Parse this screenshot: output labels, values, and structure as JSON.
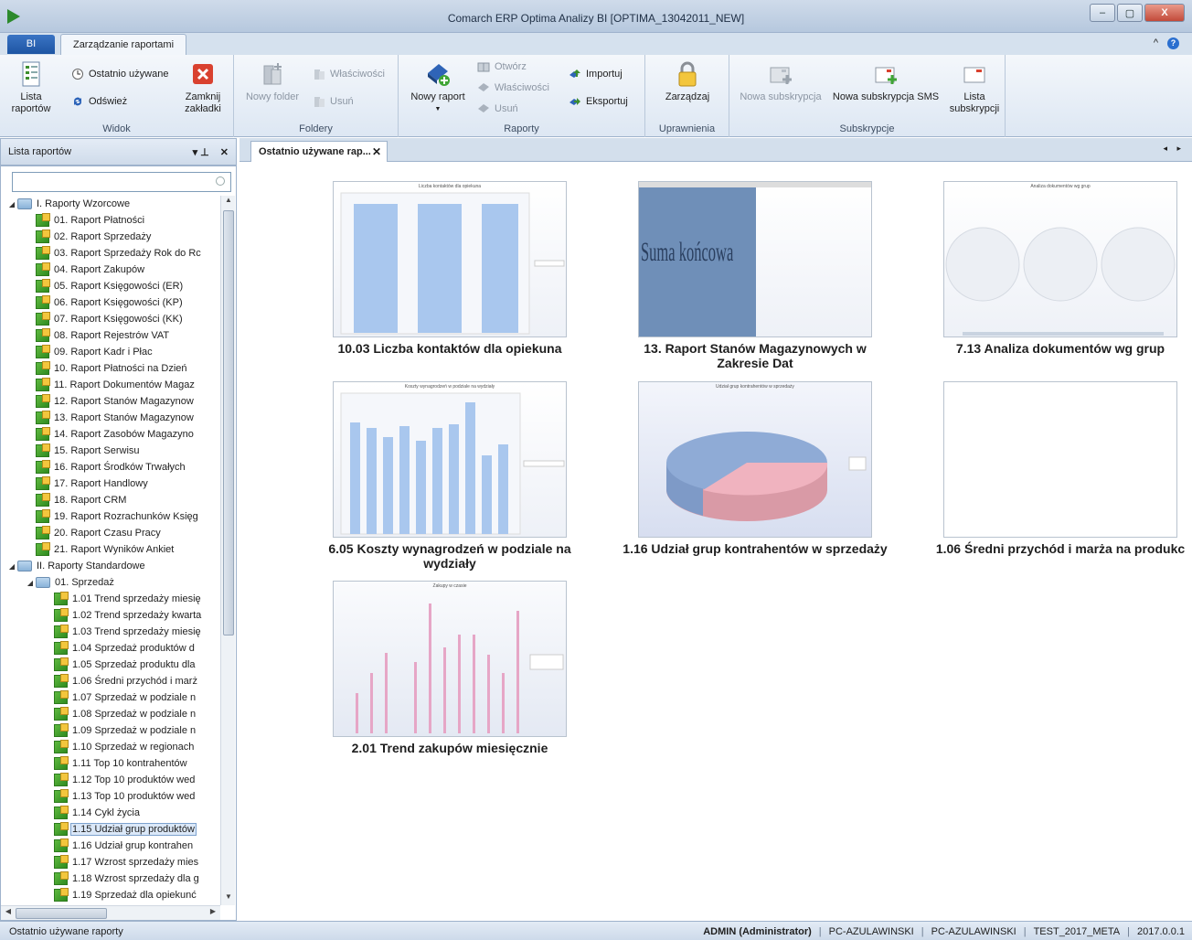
{
  "window": {
    "title": "Comarch ERP Optima Analizy BI [OPTIMA_13042011_NEW]",
    "minimize": "–",
    "maximize": "▢",
    "close": "X"
  },
  "ribbon_tabs": {
    "app_tab": "BI",
    "active_tab": "Zarządzanie raportami"
  },
  "ribbon": {
    "widok": {
      "label": "Widok",
      "lista_raportow": "Lista raportów",
      "ostatnio_uzywane": "Ostatnio używane",
      "odswiez": "Odśwież",
      "zamknij_zakladki": "Zamknij zakładki"
    },
    "foldery": {
      "label": "Foldery",
      "nowy_folder": "Nowy folder",
      "wlasciwosci": "Właściwości",
      "usun": "Usuń"
    },
    "raporty": {
      "label": "Raporty",
      "nowy_raport": "Nowy raport",
      "otworz": "Otwórz",
      "wlasciwosci": "Właściwości",
      "usun": "Usuń",
      "importuj": "Importuj",
      "eksportuj": "Eksportuj"
    },
    "uprawnienia": {
      "label": "Uprawnienia",
      "zarzadzaj": "Zarządzaj"
    },
    "subskrypcje": {
      "label": "Subskrypcje",
      "nowa_subskrypcja": "Nowa subskrypcja",
      "nowa_subskrypcja_sms": "Nowa subskrypcja SMS",
      "lista_subskrypcji": "Lista subskrypcji"
    }
  },
  "left_pane": {
    "title": "Lista raportów",
    "search_placeholder": "",
    "pin": "▾  ⊥",
    "close": "✕"
  },
  "tree": [
    {
      "level": 0,
      "type": "folder",
      "label": "I. Raporty Wzorcowe"
    },
    {
      "level": 1,
      "type": "report",
      "label": "01. Raport Płatności"
    },
    {
      "level": 1,
      "type": "report",
      "label": "02. Raport Sprzedaży"
    },
    {
      "level": 1,
      "type": "report",
      "label": "03. Raport Sprzedaży Rok do Rc"
    },
    {
      "level": 1,
      "type": "report",
      "label": "04. Raport Zakupów"
    },
    {
      "level": 1,
      "type": "report",
      "label": "05. Raport Księgowości (ER)"
    },
    {
      "level": 1,
      "type": "report",
      "label": "06. Raport Księgowości (KP)"
    },
    {
      "level": 1,
      "type": "report",
      "label": "07. Raport Księgowości (KK)"
    },
    {
      "level": 1,
      "type": "report",
      "label": "08. Raport Rejestrów VAT"
    },
    {
      "level": 1,
      "type": "report",
      "label": "09. Raport Kadr i Płac"
    },
    {
      "level": 1,
      "type": "report",
      "label": "10. Raport Płatności na Dzień"
    },
    {
      "level": 1,
      "type": "report",
      "label": "11. Raport Dokumentów Magaz"
    },
    {
      "level": 1,
      "type": "report",
      "label": "12. Raport Stanów Magazynow"
    },
    {
      "level": 1,
      "type": "report",
      "label": "13. Raport Stanów Magazynow"
    },
    {
      "level": 1,
      "type": "report",
      "label": "14. Raport Zasobów Magazyno"
    },
    {
      "level": 1,
      "type": "report",
      "label": "15. Raport Serwisu"
    },
    {
      "level": 1,
      "type": "report",
      "label": "16. Raport Środków Trwałych"
    },
    {
      "level": 1,
      "type": "report",
      "label": "17. Raport Handlowy"
    },
    {
      "level": 1,
      "type": "report",
      "label": "18. Raport CRM"
    },
    {
      "level": 1,
      "type": "report",
      "label": "19. Raport Rozrachunków Księg"
    },
    {
      "level": 1,
      "type": "report",
      "label": "20. Raport Czasu Pracy"
    },
    {
      "level": 1,
      "type": "report",
      "label": "21. Raport Wyników Ankiet"
    },
    {
      "level": 0,
      "type": "folder",
      "label": "II. Raporty Standardowe"
    },
    {
      "level": 1,
      "type": "folder",
      "label": "01. Sprzedaż"
    },
    {
      "level": 2,
      "type": "report",
      "label": "1.01 Trend sprzedaży miesię"
    },
    {
      "level": 2,
      "type": "report",
      "label": "1.02 Trend sprzedaży kwarta"
    },
    {
      "level": 2,
      "type": "report",
      "label": "1.03 Trend sprzedaży miesię"
    },
    {
      "level": 2,
      "type": "report",
      "label": "1.04 Sprzedaż produktów d"
    },
    {
      "level": 2,
      "type": "report",
      "label": "1.05 Sprzedaż produktu dla"
    },
    {
      "level": 2,
      "type": "report",
      "label": "1.06 Średni przychód i marż"
    },
    {
      "level": 2,
      "type": "report",
      "label": "1.07 Sprzedaż w podziale n"
    },
    {
      "level": 2,
      "type": "report",
      "label": "1.08 Sprzedaż w podziale n"
    },
    {
      "level": 2,
      "type": "report",
      "label": "1.09 Sprzedaż w podziale n"
    },
    {
      "level": 2,
      "type": "report",
      "label": "1.10 Sprzedaż w regionach"
    },
    {
      "level": 2,
      "type": "report",
      "label": "1.11 Top 10 kontrahentów"
    },
    {
      "level": 2,
      "type": "report",
      "label": "1.12 Top 10 produktów wed"
    },
    {
      "level": 2,
      "type": "report",
      "label": "1.13 Top 10 produktów wed"
    },
    {
      "level": 2,
      "type": "report",
      "label": "1.14 Cykl życia"
    },
    {
      "level": 2,
      "type": "report",
      "label": "1.15 Udział grup produktów",
      "selected": true
    },
    {
      "level": 2,
      "type": "report",
      "label": "1.16 Udział grup kontrahen"
    },
    {
      "level": 2,
      "type": "report",
      "label": "1.17 Wzrost sprzedaży mies"
    },
    {
      "level": 2,
      "type": "report",
      "label": "1.18 Wzrost sprzedaży dla g"
    },
    {
      "level": 2,
      "type": "report",
      "label": "1.19 Sprzedaż dla opiekunć"
    }
  ],
  "main": {
    "tab_label": "Ostatnio używane rap...",
    "tab_close": "✕",
    "tab_nav": "◂ ▸",
    "cards": [
      {
        "caption": "10.03 Liczba kontaktów dla opiekuna",
        "thumb_title": "Liczba kontaktów dla opiekuna"
      },
      {
        "caption": "13. Raport Stanów Magazynowych w Zakresie Dat",
        "thumb_text": "Suma końcowa"
      },
      {
        "caption": "7.13 Analiza dokumentów wg grup",
        "thumb_title": "Analiza dokumentów wg grup"
      },
      {
        "caption": "6.05 Koszty wynagrodzeń w podziale na wydziały",
        "thumb_title": "Koszty wynagrodzeń w podziale na wydziały"
      },
      {
        "caption": "1.16 Udział grup kontrahentów w sprzedaży",
        "thumb_title": "Udział grup kontrahentów w sprzedaży"
      },
      {
        "caption": "1.06 Średni przychód i marża na produkc",
        "thumb_title": ""
      },
      {
        "caption": "2.01 Trend zakupów miesięcznie",
        "thumb_title": "Zakupy w czasie"
      }
    ]
  },
  "status": {
    "left": "Ostatnio używane raporty",
    "user": "ADMIN (Administrator)",
    "pc1": "PC-AZULAWINSKI",
    "pc2": "PC-AZULAWINSKI",
    "db": "TEST_2017_META",
    "version": "2017.0.0.1",
    "sep": "|"
  }
}
